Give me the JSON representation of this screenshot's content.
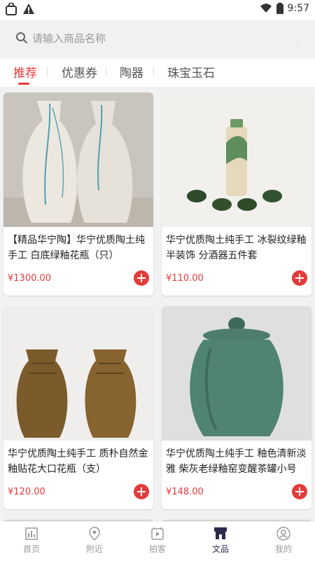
{
  "status": {
    "time": "9:57"
  },
  "search": {
    "placeholder": "请输入商品名称"
  },
  "tabs": [
    {
      "label": "推荐"
    },
    {
      "label": "优惠券"
    },
    {
      "label": "陶器"
    },
    {
      "label": "珠宝玉石"
    }
  ],
  "products": [
    {
      "title": "【精品华宁陶】华宁优质陶土纯手工 白底绿釉花瓶（只）",
      "price": "¥1300.00"
    },
    {
      "title": "华宁优质陶土纯手工  冰裂纹绿釉半装饰 分酒器五件套",
      "price": "¥110.00"
    },
    {
      "title": "华宁优质陶土纯手工  质朴自然金釉贴花大口花瓶（支）",
      "price": "¥120.00"
    },
    {
      "title": "华宁优质陶土纯手工 釉色清新淡雅 柴灰老绿釉窑变醒茶罐小号",
      "price": "¥148.00"
    }
  ],
  "bottom_nav": [
    {
      "label": "首页"
    },
    {
      "label": "附近"
    },
    {
      "label": "拍客"
    },
    {
      "label": "文品"
    },
    {
      "label": "我的"
    }
  ],
  "colors": {
    "accent": "#e43b3b",
    "nav_active": "#2a2a4a"
  }
}
